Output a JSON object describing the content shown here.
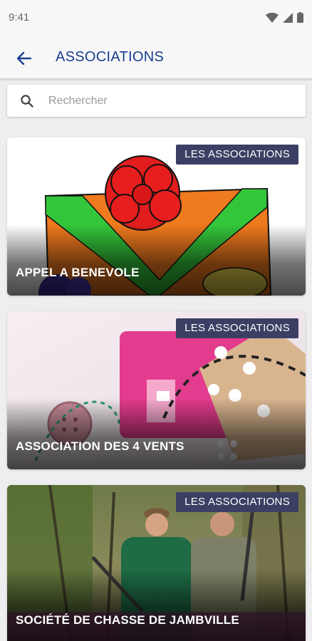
{
  "status_bar": {
    "time": "9:41"
  },
  "app_bar": {
    "title": "ASSOCIATIONS"
  },
  "search": {
    "placeholder": "Rechercher"
  },
  "cards": [
    {
      "badge": "LES ASSOCIATIONS",
      "name": "APPEL A BENEVOLE"
    },
    {
      "badge": "LES ASSOCIATIONS",
      "name": "ASSOCIATION DES 4 VENTS"
    },
    {
      "badge": "LES ASSOCIATIONS",
      "name": "SOCIÉTÉ DE CHASSE DE JAMBVILLE"
    }
  ],
  "colors": {
    "title_blue": "#1a3f8f",
    "badge_bg": "#3b3f63"
  }
}
